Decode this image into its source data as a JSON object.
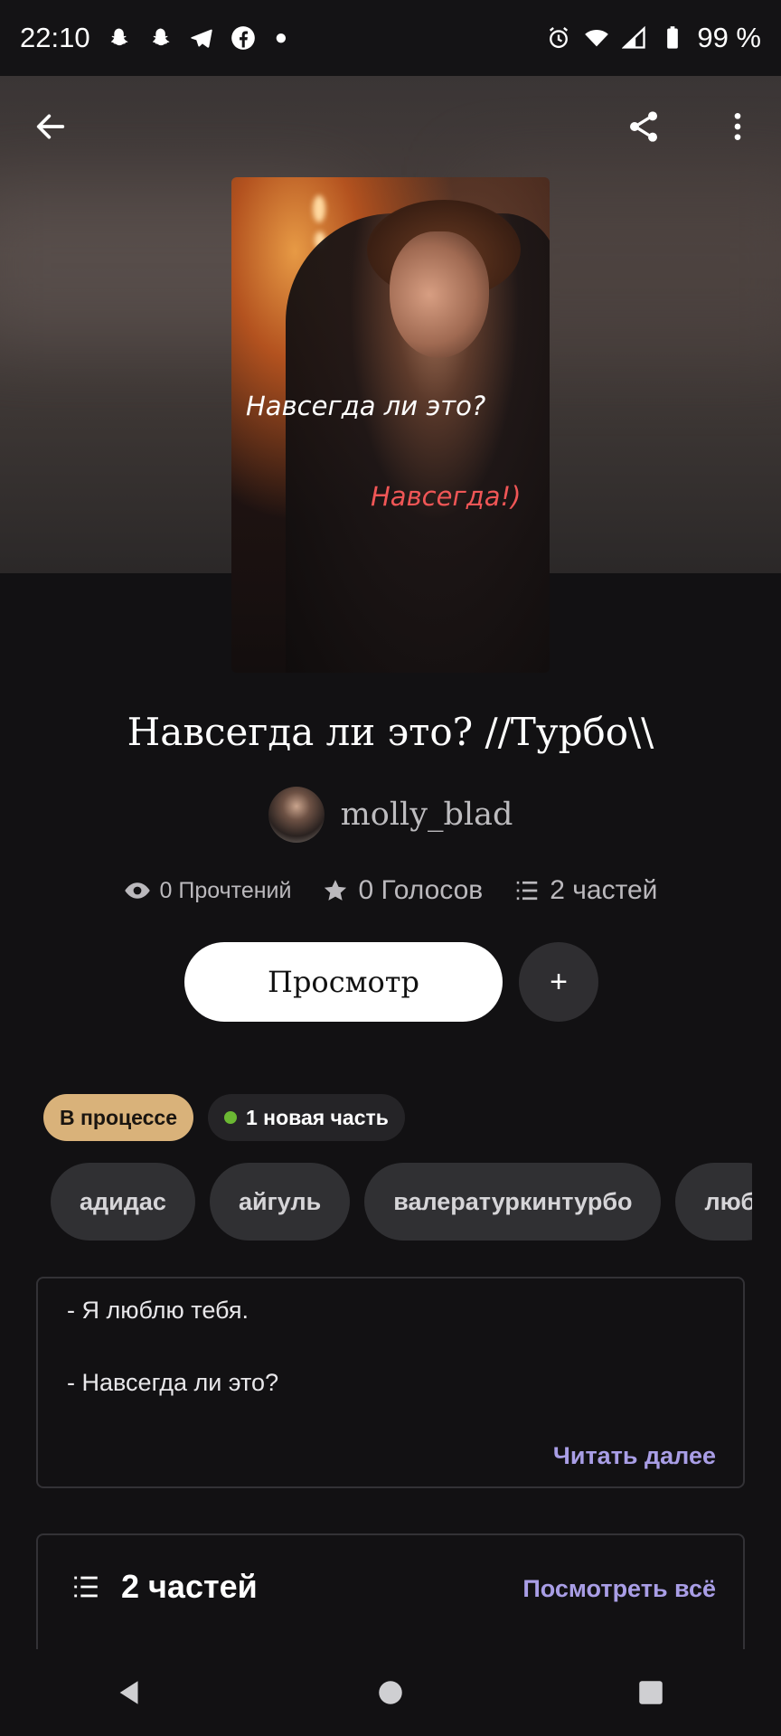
{
  "status_bar": {
    "time": "22:10",
    "battery": "99 %"
  },
  "cover": {
    "line1": "Навсегда ли это?",
    "line2": "Навсегда!)"
  },
  "story": {
    "title": "Навсегда ли это? //Турбо\\\\",
    "author": "molly_blad",
    "reads": "0 Прочтений",
    "votes": "0 Голосов",
    "parts": "2 частей"
  },
  "actions": {
    "view_label": "Просмотр",
    "add_label": "+"
  },
  "badges": {
    "status": "В процессе",
    "new_part": "1 новая часть"
  },
  "tags": [
    "адидас",
    "айгуль",
    "валературкинтурбо",
    "люб"
  ],
  "description": {
    "line1": "- Я люблю тебя.",
    "line2": "- Навсегда ли это?",
    "read_more": "Читать далее"
  },
  "parts_section": {
    "title": "2 частей",
    "see_all": "Посмотреть всё"
  },
  "colors": {
    "accent": "#a99ee6",
    "status_badge": "#d9b27a",
    "new_dot": "#6bb833"
  }
}
